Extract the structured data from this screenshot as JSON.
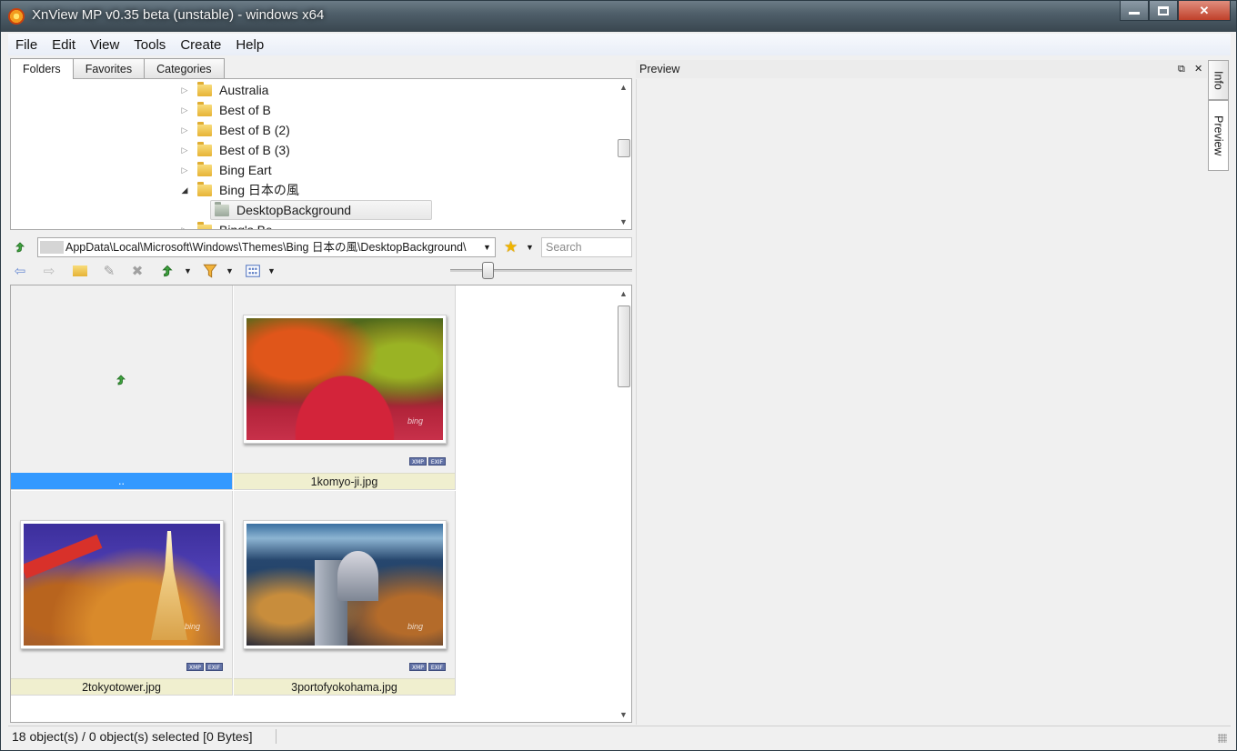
{
  "window": {
    "title": "XnView MP v0.35 beta (unstable) - windows x64"
  },
  "menu": {
    "items": [
      {
        "label": "File"
      },
      {
        "label": "Edit"
      },
      {
        "label": "View"
      },
      {
        "label": "Tools"
      },
      {
        "label": "Create"
      },
      {
        "label": "Help"
      }
    ]
  },
  "folder_panel": {
    "tabs": [
      {
        "label": "Folders"
      },
      {
        "label": "Favorites"
      },
      {
        "label": "Categories"
      }
    ],
    "tree": [
      {
        "label": "Australia",
        "expanded": false
      },
      {
        "label": "Best of B",
        "expanded": false
      },
      {
        "label": "Best of B (2)",
        "expanded": false
      },
      {
        "label": "Best of B (3)",
        "expanded": false
      },
      {
        "label": "Bing Eart",
        "expanded": false
      },
      {
        "label": "Bing 日本の風",
        "expanded": true
      },
      {
        "label": "DesktopBackground",
        "selected": true
      },
      {
        "label": "Bing's Be",
        "expanded": false
      }
    ]
  },
  "address": {
    "path": "AppData\\Local\\Microsoft\\Windows\\Themes\\Bing 日本の風\\DesktopBackground\\",
    "search_placeholder": "Search"
  },
  "browser": {
    "items": [
      {
        "label": "..",
        "type": "parent",
        "selected": true
      },
      {
        "label": "1komyo-ji.jpg",
        "badges": [
          "XMP",
          "EXIF"
        ]
      },
      {
        "label": "2tokyotower.jpg",
        "badges": [
          "XMP",
          "EXIF"
        ]
      },
      {
        "label": "3portofyokohama.jpg",
        "badges": [
          "XMP",
          "EXIF"
        ]
      }
    ],
    "watermark": "bing"
  },
  "preview": {
    "title": "Preview",
    "side_tabs": [
      {
        "label": "Info"
      },
      {
        "label": "Preview"
      }
    ]
  },
  "status": {
    "text": "18 object(s) / 0 object(s) selected [0 Bytes]"
  },
  "colors": {
    "selection": "#3399ff",
    "label_bg": "#f0efcf",
    "folder": "#e6b336"
  }
}
